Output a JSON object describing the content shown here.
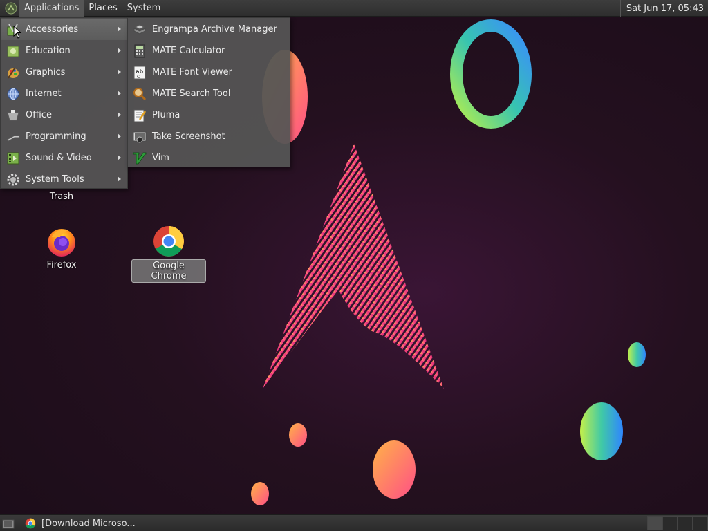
{
  "top_panel": {
    "menus": [
      "Applications",
      "Places",
      "System"
    ],
    "clock": "Sat Jun 17, 05:43"
  },
  "applications_menu": {
    "categories": [
      {
        "label": "Accessories",
        "icon": "accessories-icon"
      },
      {
        "label": "Education",
        "icon": "education-icon"
      },
      {
        "label": "Graphics",
        "icon": "graphics-icon"
      },
      {
        "label": "Internet",
        "icon": "internet-icon"
      },
      {
        "label": "Office",
        "icon": "office-icon"
      },
      {
        "label": "Programming",
        "icon": "programming-icon"
      },
      {
        "label": "Sound & Video",
        "icon": "sound-video-icon"
      },
      {
        "label": "System Tools",
        "icon": "system-tools-icon"
      }
    ],
    "selected": "Accessories"
  },
  "accessories_submenu": {
    "items": [
      {
        "label": "Engrampa Archive Manager",
        "icon": "archive-manager-icon"
      },
      {
        "label": "MATE Calculator",
        "icon": "calculator-icon"
      },
      {
        "label": "MATE Font Viewer",
        "icon": "font-viewer-icon"
      },
      {
        "label": "MATE Search Tool",
        "icon": "search-tool-icon"
      },
      {
        "label": "Pluma",
        "icon": "text-editor-icon"
      },
      {
        "label": "Take Screenshot",
        "icon": "screenshot-icon"
      },
      {
        "label": "Vim",
        "icon": "vim-icon"
      }
    ]
  },
  "desktop": {
    "icons": [
      {
        "label": "Trash",
        "icon": "trash-icon"
      },
      {
        "label": "Firefox",
        "icon": "firefox-icon"
      },
      {
        "label": "Google Chrome",
        "icon": "chrome-icon",
        "selected": true
      }
    ]
  },
  "bottom_panel": {
    "task_label": "[Download Microso..."
  },
  "colors": {
    "panel_bg": "#333333",
    "menu_bg": "#555555",
    "menu_selected": "#656565",
    "wallpaper_bg": "#24101f",
    "accent_pink": "#e83a8a",
    "accent_orange": "#ff8a3d"
  }
}
